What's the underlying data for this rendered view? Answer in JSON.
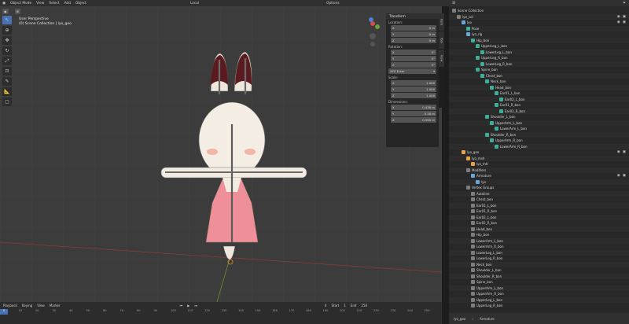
{
  "header": {
    "mode": "Object Mode",
    "menus": [
      "View",
      "Select",
      "Add",
      "Object"
    ],
    "orientation": "Local",
    "options": "Options"
  },
  "viewport": {
    "view_name": "User Perspective",
    "collection": "(0) Scene Collection | lyo_geo"
  },
  "sidebar_tabs": [
    "Item",
    "Tool",
    "View"
  ],
  "transform": {
    "title": "Transform",
    "location_label": "Location:",
    "rotation_label": "Rotation:",
    "scale_label": "Scale:",
    "dimensions_label": "Dimensions:",
    "axes": [
      "X",
      "Y",
      "Z"
    ],
    "location": [
      "0 m",
      "0 m",
      "0 m"
    ],
    "rotation": [
      "0°",
      "0°",
      "0°"
    ],
    "rotation_mode": "XYZ Euler",
    "scale": [
      "1.000",
      "1.000",
      "1.000"
    ],
    "dimensions": [
      "0.438 m",
      "0.18 m",
      "0.595 m"
    ]
  },
  "timeline": {
    "menus": [
      "Playback",
      "Keying",
      "View",
      "Marker"
    ],
    "current_frame": "0",
    "start_label": "Start",
    "start": "1",
    "end_label": "End",
    "end": "250",
    "ticks": [
      "0",
      "10",
      "20",
      "30",
      "40",
      "50",
      "60",
      "70",
      "80",
      "90",
      "100",
      "110",
      "120",
      "130",
      "140",
      "150",
      "160",
      "170",
      "180",
      "190",
      "200",
      "210",
      "220",
      "230",
      "240",
      "250"
    ]
  },
  "outliner": {
    "rows": [
      {
        "label": "Scene Collection",
        "depth": 0,
        "icon": "grp",
        "vis": false
      },
      {
        "label": "lyo_col",
        "depth": 1,
        "icon": "grp",
        "vis": true
      },
      {
        "label": "lyo",
        "depth": 2,
        "icon": "arm",
        "vis": true
      },
      {
        "label": "Pose",
        "depth": 3,
        "icon": "bone",
        "vis": false
      },
      {
        "label": "lyo_rig",
        "depth": 3,
        "icon": "arm",
        "vis": false
      },
      {
        "label": "Hip_bon",
        "depth": 4,
        "icon": "bone",
        "vis": false
      },
      {
        "label": "UpperLeg_L_bon",
        "depth": 5,
        "icon": "bone",
        "vis": false
      },
      {
        "label": "LowerLeg_L_bon",
        "depth": 6,
        "icon": "bone",
        "vis": false
      },
      {
        "label": "UpperLeg_R_bon",
        "depth": 5,
        "icon": "bone",
        "vis": false
      },
      {
        "label": "LowerLeg_R_bon",
        "depth": 6,
        "icon": "bone",
        "vis": false
      },
      {
        "label": "Spine_bon",
        "depth": 5,
        "icon": "bone",
        "vis": false
      },
      {
        "label": "Chest_bon",
        "depth": 6,
        "icon": "bone",
        "vis": false
      },
      {
        "label": "Neck_bon",
        "depth": 7,
        "icon": "bone",
        "vis": false
      },
      {
        "label": "Head_bon",
        "depth": 8,
        "icon": "bone",
        "vis": false
      },
      {
        "label": "Ear01_L_bon",
        "depth": 9,
        "icon": "bone",
        "vis": false
      },
      {
        "label": "Ear02_L_bon",
        "depth": 10,
        "icon": "bone",
        "vis": false
      },
      {
        "label": "Ear01_R_bon",
        "depth": 9,
        "icon": "bone",
        "vis": false
      },
      {
        "label": "Ear02_R_bon",
        "depth": 10,
        "icon": "bone",
        "vis": false
      },
      {
        "label": "Shoulder_L_bon",
        "depth": 7,
        "icon": "bone",
        "vis": false
      },
      {
        "label": "UpperArm_L_bon",
        "depth": 8,
        "icon": "bone",
        "vis": false
      },
      {
        "label": "LowerArm_L_bon",
        "depth": 9,
        "icon": "bone",
        "vis": false
      },
      {
        "label": "Shoulder_R_bon",
        "depth": 7,
        "icon": "bone",
        "vis": false
      },
      {
        "label": "UpperArm_R_bon",
        "depth": 8,
        "icon": "bone",
        "vis": false
      },
      {
        "label": "LowerArm_R_bon",
        "depth": 9,
        "icon": "bone",
        "vis": false
      },
      {
        "label": "lyo_geo",
        "depth": 2,
        "icon": "mesh",
        "vis": true
      },
      {
        "label": "lyo_msh",
        "depth": 3,
        "icon": "mesh",
        "vis": false
      },
      {
        "label": "lyo_mtl",
        "depth": 4,
        "icon": "mesh",
        "vis": false
      },
      {
        "label": "Modifiers",
        "depth": 3,
        "icon": "grp",
        "vis": false
      },
      {
        "label": "Armature",
        "depth": 4,
        "icon": "arm",
        "vis": true
      },
      {
        "label": "lyo",
        "depth": 5,
        "icon": "arm",
        "vis": false
      },
      {
        "label": "Vertex Groups",
        "depth": 3,
        "icon": "grp",
        "vis": false
      },
      {
        "label": "Autoline",
        "depth": 4,
        "icon": "grp",
        "vis": false
      },
      {
        "label": "Chest_bon",
        "depth": 4,
        "icon": "grp",
        "vis": false
      },
      {
        "label": "Ear01_L_bon",
        "depth": 4,
        "icon": "grp",
        "vis": false
      },
      {
        "label": "Ear01_R_bon",
        "depth": 4,
        "icon": "grp",
        "vis": false
      },
      {
        "label": "Ear02_L_bon",
        "depth": 4,
        "icon": "grp",
        "vis": false
      },
      {
        "label": "Ear02_R_bon",
        "depth": 4,
        "icon": "grp",
        "vis": false
      },
      {
        "label": "Head_bon",
        "depth": 4,
        "icon": "grp",
        "vis": false
      },
      {
        "label": "Hip_bon",
        "depth": 4,
        "icon": "grp",
        "vis": false
      },
      {
        "label": "LowerArm_L_bon",
        "depth": 4,
        "icon": "grp",
        "vis": false
      },
      {
        "label": "LowerArm_R_bon",
        "depth": 4,
        "icon": "grp",
        "vis": false
      },
      {
        "label": "LowerLeg_L_bon",
        "depth": 4,
        "icon": "grp",
        "vis": false
      },
      {
        "label": "LowerLeg_R_bon",
        "depth": 4,
        "icon": "grp",
        "vis": false
      },
      {
        "label": "Neck_bon",
        "depth": 4,
        "icon": "grp",
        "vis": false
      },
      {
        "label": "Shoulder_L_bon",
        "depth": 4,
        "icon": "grp",
        "vis": false
      },
      {
        "label": "Shoulder_R_bon",
        "depth": 4,
        "icon": "grp",
        "vis": false
      },
      {
        "label": "Spine_bon",
        "depth": 4,
        "icon": "grp",
        "vis": false
      },
      {
        "label": "UpperArm_L_bon",
        "depth": 4,
        "icon": "grp",
        "vis": false
      },
      {
        "label": "UpperArm_R_bon",
        "depth": 4,
        "icon": "grp",
        "vis": false
      },
      {
        "label": "UpperLeg_L_bon",
        "depth": 4,
        "icon": "grp",
        "vis": false
      },
      {
        "label": "UpperLeg_R_bon",
        "depth": 4,
        "icon": "grp",
        "vis": false
      }
    ]
  },
  "status": {
    "object": "lyo_geo",
    "separator": "›",
    "data": "Armature"
  }
}
